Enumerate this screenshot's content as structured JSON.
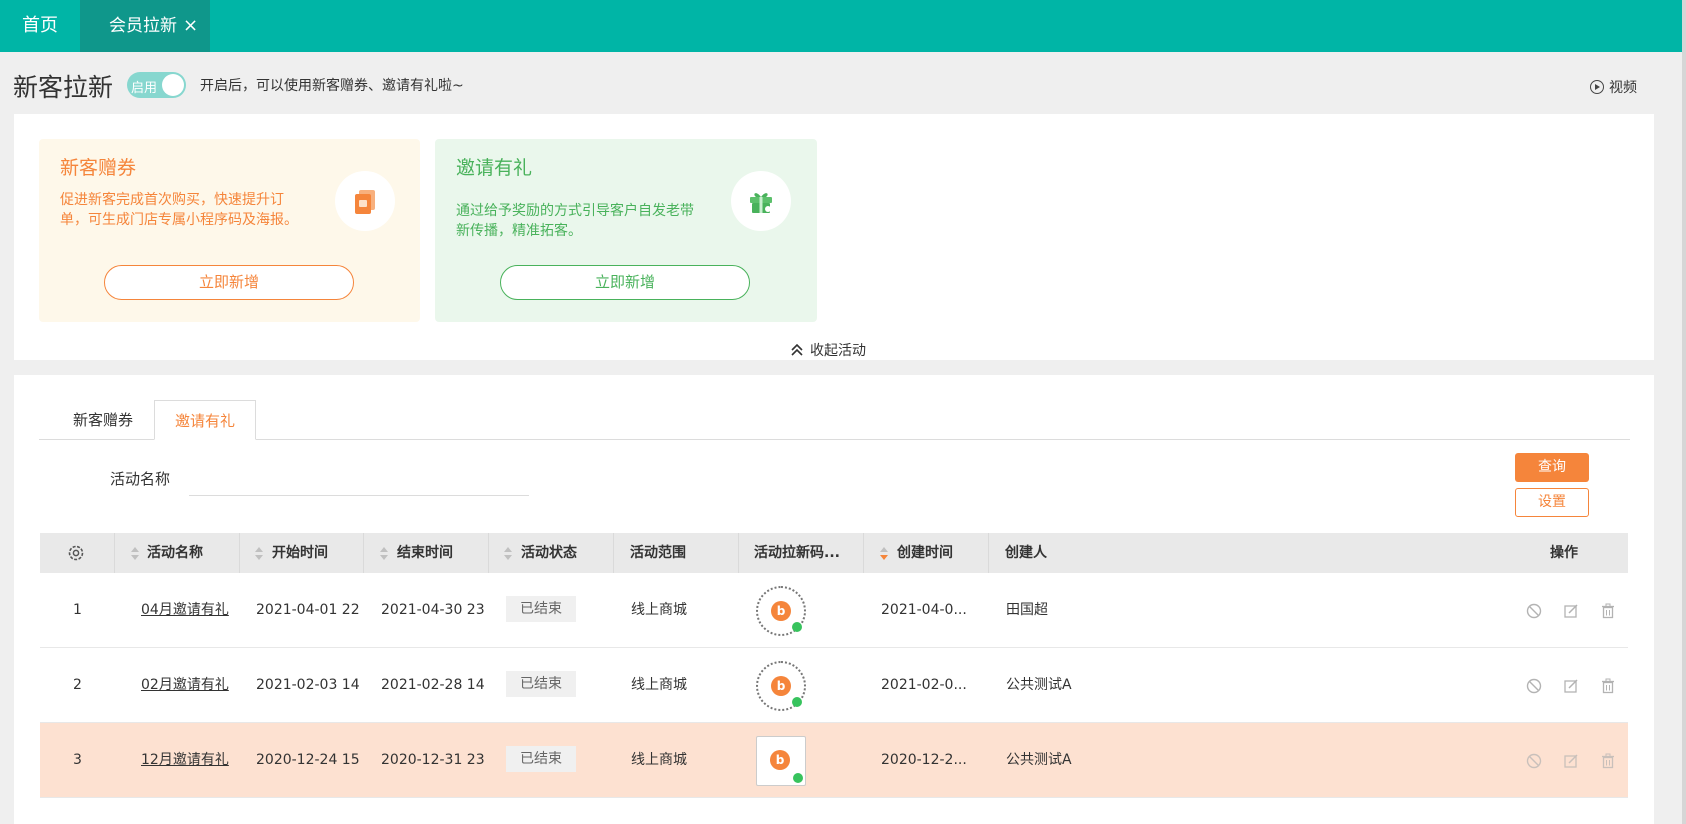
{
  "topbar": {
    "home_label": "首页",
    "active_tab_label": "会员拉新",
    "close_symbol": "×"
  },
  "header": {
    "title": "新客拉新",
    "toggle_label": "启用",
    "toggle_on": true,
    "toggle_hint": "开启后，可以使用新客赠券、邀请有礼啦~",
    "video_label": "视频"
  },
  "cards": {
    "coupon": {
      "title": "新客赠券",
      "desc": "促进新客完成首次购买，快速提升订单，可生成门店专属小程序码及海报。",
      "button": "立即新增",
      "icon": "coupon-icon",
      "color": "#f5853b"
    },
    "invite": {
      "title": "邀请有礼",
      "desc": "通过给予奖励的方式引导客户自发老带新传播，精准拓客。",
      "button": "立即新增",
      "icon": "gift-icon",
      "color": "#49b25b"
    },
    "collapse_label": "收起活动"
  },
  "list": {
    "tabs": [
      "新客赠券",
      "邀请有礼"
    ],
    "active_tab": "邀请有礼",
    "filter_label": "活动名称",
    "filter_value": "",
    "query_button": "查询",
    "settings_button": "设置",
    "columns": [
      "活动名称",
      "开始时间",
      "结束时间",
      "活动状态",
      "活动范围",
      "活动拉新码...",
      "创建时间",
      "创建人",
      "操作"
    ],
    "rows": [
      {
        "index": "1",
        "name": "04月邀请有礼",
        "start": "2021-04-01 22:",
        "end": "2021-04-30 23:",
        "status": "已结束",
        "scope": "线上商城",
        "created": "2021-04-0...",
        "creator": "田国超"
      },
      {
        "index": "2",
        "name": "02月邀请有礼",
        "start": "2021-02-03 14:",
        "end": "2021-02-28 14:",
        "status": "已结束",
        "scope": "线上商城",
        "created": "2021-02-0...",
        "creator": "公共测试A"
      },
      {
        "index": "3",
        "name": "12月邀请有礼",
        "start": "2020-12-24 15:",
        "end": "2020-12-31 23:",
        "status": "已结束",
        "scope": "线上商城",
        "created": "2020-12-2...",
        "creator": "公共测试A"
      }
    ]
  },
  "colors": {
    "brand": "#00b5a6",
    "accent": "#f5853b",
    "row_highlight": "#fde1d1"
  }
}
